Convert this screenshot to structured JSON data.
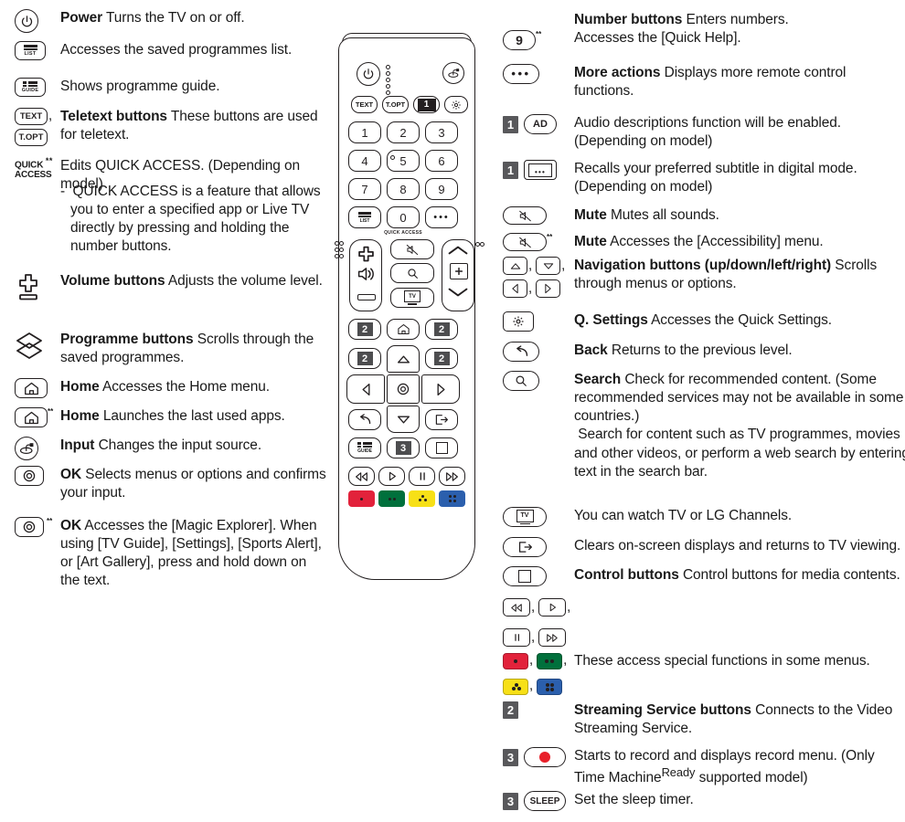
{
  "left_column": [
    {
      "id": "power",
      "icons": [
        "power-round"
      ],
      "text_html": "<b>Power</b>  Turns the TV on or off."
    },
    {
      "id": "list",
      "icons": [
        "list-key"
      ],
      "text_html": "Accesses the saved programmes list."
    },
    {
      "id": "guide",
      "icons": [
        "guide-key"
      ],
      "text_html": "Shows programme guide."
    },
    {
      "id": "teletext",
      "icons": [
        "text-key",
        "topt-key"
      ],
      "text_html": "<b>Teletext buttons</b>  These buttons are used for teletext."
    },
    {
      "id": "quick-access",
      "icons": [
        "quick-access-label"
      ],
      "text_html": "Edits QUICK ACCESS. (Depending on model)"
    },
    {
      "id": "quick-access-note",
      "icons": [],
      "text_html": "-&nbsp; QUICK ACCESS is a feature that allows you to enter a specified app or Live TV directly by pressing and holding the number buttons."
    },
    {
      "id": "volume",
      "icons": [
        "volume-rocker"
      ],
      "text_html": "<b>Volume buttons</b>  Adjusts the volume level."
    },
    {
      "id": "programme",
      "icons": [
        "programme-rocker"
      ],
      "text_html": "<b>Programme buttons</b>  Scrolls through the saved programmes."
    },
    {
      "id": "home",
      "icons": [
        "home-key"
      ],
      "text_html": "<b>Home</b>  Accesses the Home menu."
    },
    {
      "id": "home-2",
      "icons": [
        "home-key-star"
      ],
      "text_html": "<b>Home</b>  Launches the last used apps."
    },
    {
      "id": "input",
      "icons": [
        "input-round"
      ],
      "text_html": "<b>Input</b>  Changes the input source."
    },
    {
      "id": "ok",
      "icons": [
        "ok-key"
      ],
      "text_html": "<b>OK</b>  Selects menus or options and confirms your input."
    },
    {
      "id": "ok-2",
      "icons": [
        "ok-key-star"
      ],
      "text_html": "<b>OK</b>  Accesses the [Magic Explorer]. When using [TV Guide], [Settings], [Sports Alert], or [Art Gallery], press and hold down on the text."
    }
  ],
  "right_column": [
    {
      "id": "number-buttons",
      "icons": [
        "num9-key-star"
      ],
      "text_html": "<b>Number buttons</b>  Enters numbers.<br>Accesses the [Quick Help]."
    },
    {
      "id": "more-actions",
      "icons": [
        "dots-key"
      ],
      "text_html": "<b>More actions</b>  Displays more remote control functions."
    },
    {
      "id": "audio-description",
      "icons": [
        "badge-1",
        "ad-key"
      ],
      "text_html": "Audio descriptions function will be enabled. (Depending on model)"
    },
    {
      "id": "subtitle",
      "icons": [
        "badge-1",
        "subtitle-key"
      ],
      "text_html": "Recalls your preferred subtitle in digital mode. (Depending on model)"
    },
    {
      "id": "mute",
      "icons": [
        "mute-key"
      ],
      "text_html": "<b>Mute</b>  Mutes all sounds."
    },
    {
      "id": "mute-2",
      "icons": [
        "mute-key-star"
      ],
      "text_html": "<b>Mute</b>  Accesses the [Accessibility] menu."
    },
    {
      "id": "navigation",
      "icons": [
        "nav-up",
        "nav-down",
        "nav-left",
        "nav-right"
      ],
      "text_html": "<b>Navigation buttons (up/down/left/right)</b>  Scrolls through menus or options."
    },
    {
      "id": "q-settings",
      "icons": [
        "gear-key"
      ],
      "text_html": "<b>Q. Settings</b>  Accesses the Quick Settings."
    },
    {
      "id": "back",
      "icons": [
        "back-key"
      ],
      "text_html": "<b>Back</b>  Returns to the previous level."
    },
    {
      "id": "search",
      "icons": [
        "search-key"
      ],
      "text_html": "<b>Search</b>  Check for recommended content. (Some recommended services may not be available in some countries.)<br>&nbsp;Search for content such as TV programmes, movies and other videos, or perform a web search by entering text in the search bar."
    },
    {
      "id": "live-tv",
      "icons": [
        "tv-key"
      ],
      "text_html": "You can watch TV or LG Channels."
    },
    {
      "id": "exit",
      "icons": [
        "exit-key"
      ],
      "text_html": "Clears on-screen displays and returns to TV viewing."
    },
    {
      "id": "control-buttons",
      "icons": [
        "stop-key"
      ],
      "text_html": "<b>Control buttons</b>  Control buttons for media contents."
    },
    {
      "id": "transport-1",
      "icons": [
        "rew-key",
        "play-key"
      ],
      "text_html": ""
    },
    {
      "id": "transport-2",
      "icons": [
        "pause-key",
        "ff-key"
      ],
      "text_html": ""
    },
    {
      "id": "color-1",
      "icons": [
        "color-red",
        "color-green"
      ],
      "text_html": "These access special functions in some menus."
    },
    {
      "id": "color-2",
      "icons": [
        "color-yellow",
        "color-blue"
      ],
      "text_html": ""
    },
    {
      "id": "streaming",
      "icons": [
        "badge-2"
      ],
      "text_html": "<b>Streaming Service buttons</b>  Connects to the Video Streaming Service."
    },
    {
      "id": "record",
      "icons": [
        "badge-3",
        "record-key"
      ],
      "text_html": "Starts to record and displays record menu. (Only Time Machine<sup>Ready</sup> supported model)"
    },
    {
      "id": "sleep",
      "icons": [
        "badge-3",
        "sleep-key"
      ],
      "text_html": "Set the sleep timer."
    }
  ],
  "icon_labels": {
    "list": "LIST",
    "guide": "GUIDE",
    "text": "TEXT",
    "topt": "T.OPT",
    "quick": "QUICK",
    "access": "ACCESS",
    "ad": "AD",
    "tv": "TV",
    "sleep": "SLEEP",
    "nine": "9",
    "star": "**"
  },
  "remote": {
    "quick_access_label": "QUICK ACCESS",
    "keys_row_text": [
      "TEXT",
      "T.OPT"
    ],
    "badge_1": "1",
    "numbers": [
      "1",
      "2",
      "3",
      "4",
      "5",
      "6",
      "7",
      "8",
      "9",
      "0"
    ],
    "list_label": "LIST",
    "guide_label": "GUIDE",
    "tv_label": "TV",
    "badges": {
      "two": "2",
      "three": "3"
    }
  },
  "colors": {
    "ink": "#231f20",
    "badge_gray": "#58585b",
    "red": "#e2223b",
    "green": "#00703c",
    "yellow": "#f7e017",
    "blue": "#2b5fad",
    "record_red": "#e8202a"
  }
}
